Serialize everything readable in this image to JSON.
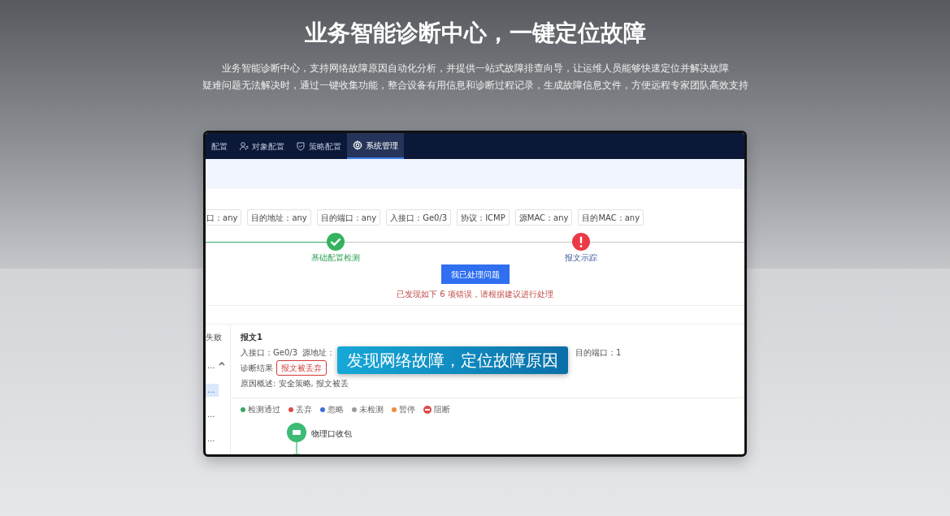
{
  "hero": {
    "title": "业务智能诊断中心，一键定位故障",
    "description": [
      "业务智能诊断中心，支持网络故障原因自动化分析，并提供一站式故障排查向导，让运维人员能够快速定位并解决故障",
      "疑难问题无法解决时，通过一键收集功能，整合设备有用信息和诊断过程记录，生成故障信息文件，方便远程专家团队高效支持"
    ]
  },
  "app": {
    "tabs": [
      {
        "label": "配置",
        "selected": false
      },
      {
        "label": "对象配置",
        "selected": false
      },
      {
        "label": "策略配置",
        "selected": false
      },
      {
        "label": "系统管理",
        "selected": true
      }
    ],
    "filters": [
      "口：any",
      "目的地址：any",
      "目的端口：any",
      "入接口：Ge0/3",
      "协议：ICMP",
      "源MAC：any",
      "目的MAC：any"
    ],
    "steps": [
      {
        "label": "基础配置检测",
        "passed": true
      },
      {
        "label": "报文示踪",
        "passed": false
      }
    ],
    "action_button": "我已处理问题",
    "error_message": "已发现如下 6 项错误，请根据建议进行处理",
    "sidebar": {
      "heading": "失败",
      "items": [
        {
          "label": "...",
          "selected": false
        },
        {
          "label": "...",
          "selected": true
        },
        {
          "label": "...",
          "selected": false
        },
        {
          "label": "...",
          "selected": false
        }
      ]
    },
    "packet": {
      "title": "报文1",
      "fields": [
        "入接口：Ge0/3",
        "源地址：",
        "目的端口：1"
      ],
      "result_label": "诊断结果",
      "result_tag": "报文被丢弃",
      "reason": "原因概述: 安全策略, 报文被丢"
    },
    "legend": [
      {
        "label": "检测通过",
        "kind": "dot",
        "color": "#3aa864"
      },
      {
        "label": "丢弃",
        "kind": "dot",
        "color": "#e04a4a"
      },
      {
        "label": "忽略",
        "kind": "dot",
        "color": "#3f6fd8"
      },
      {
        "label": "未检测",
        "kind": "dot",
        "color": "#9a9a9a"
      },
      {
        "label": "暂停",
        "kind": "dot",
        "color": "#f08a3c"
      },
      {
        "label": "阻断",
        "kind": "block",
        "color": "#e04a4a"
      }
    ],
    "flow_node": "物理口收包",
    "overlay_caption": "发现网络故障，定位故障原因"
  }
}
